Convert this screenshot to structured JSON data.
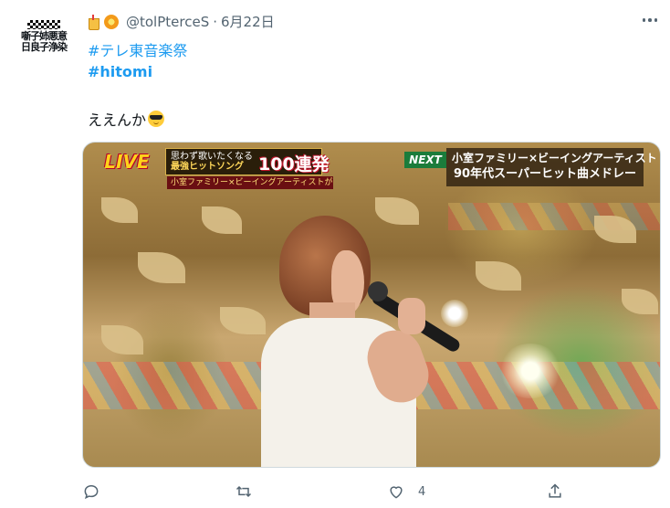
{
  "tweet": {
    "avatar_text": "噺子姉悪意日良子浄染",
    "handle": "@tolPterceS",
    "date": "6月22日",
    "hashtags": [
      "#テレ東音楽祭",
      "#hitomi"
    ],
    "text": "ええんか",
    "text_emoji": "smiling-face-with-sunglasses",
    "media": {
      "overlay_live": "LIVE",
      "overlay_banner_line1": "思わず歌いたくなる",
      "overlay_banner_line2": "最強ヒットソング",
      "overlay_banner_count": "100連発",
      "overlay_banner_sub": "小室ファミリー×ビーイングアーティストが夢の共演",
      "overlay_next": "NEXT",
      "overlay_next_line1": "小室ファミリー×ビーイングアーティスト",
      "overlay_next_line2": "90年代スーパーヒット曲メドレー"
    },
    "actions": {
      "reply_count": "",
      "retweet_count": "",
      "like_count": "4"
    }
  },
  "colors": {
    "link": "#1d9bf0",
    "secondary_text": "#536471",
    "primary_text": "#0f1419"
  }
}
